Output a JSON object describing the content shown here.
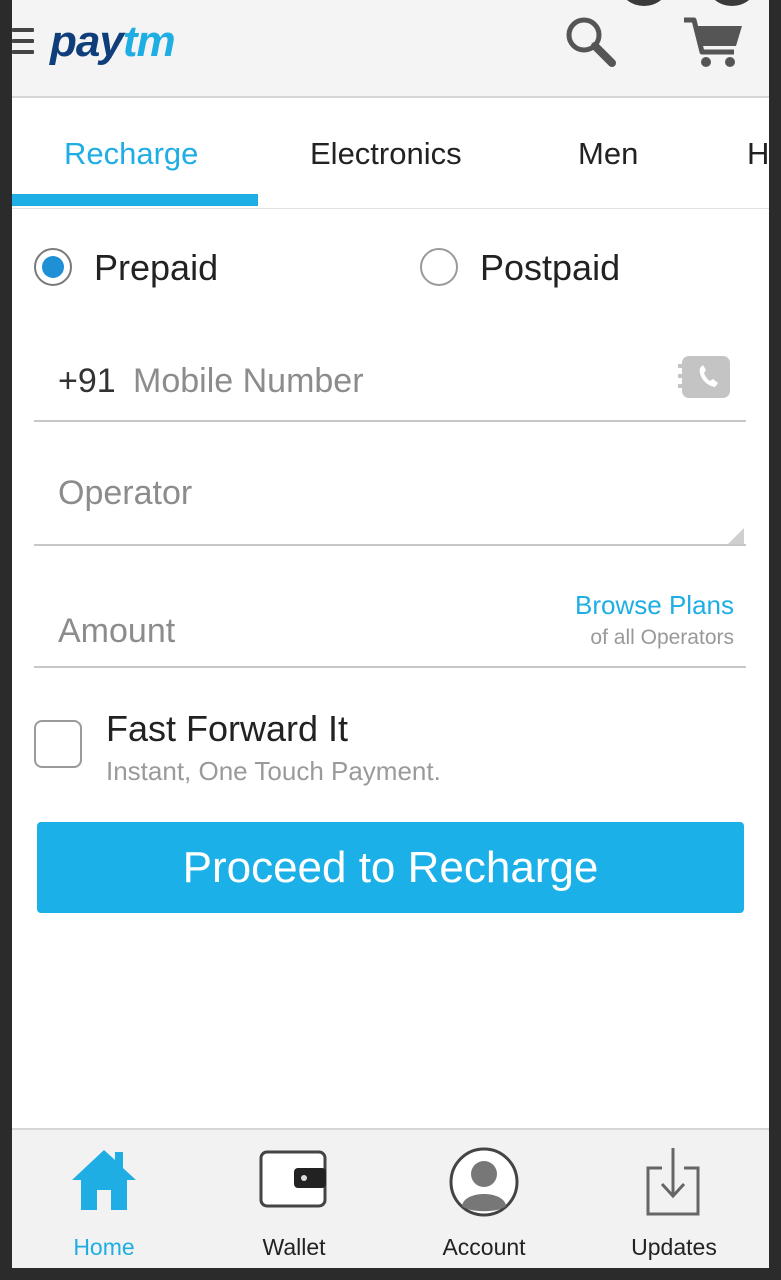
{
  "header": {
    "logo_pay": "pay",
    "logo_tm": "tm",
    "icons": [
      "menu-icon",
      "search-icon",
      "cart-icon"
    ]
  },
  "tabs": [
    {
      "label": "Recharge",
      "active": true
    },
    {
      "label": "Electronics",
      "active": false
    },
    {
      "label": "Men",
      "active": false
    },
    {
      "label": "H",
      "active": false
    }
  ],
  "recharge_type": {
    "options": [
      {
        "label": "Prepaid",
        "selected": true
      },
      {
        "label": "Postpaid",
        "selected": false
      }
    ]
  },
  "form": {
    "mobile_prefix": "+91",
    "mobile_placeholder": "Mobile Number",
    "operator_placeholder": "Operator",
    "amount_placeholder": "Amount",
    "browse_plans": "Browse Plans",
    "browse_plans_sub": "of all Operators"
  },
  "fast_forward": {
    "title": "Fast Forward It",
    "subtitle": "Instant, One Touch Payment.",
    "checked": false
  },
  "proceed_label": "Proceed to Recharge",
  "bottom_nav": [
    {
      "label": "Home",
      "icon": "home-icon",
      "active": true
    },
    {
      "label": "Wallet",
      "icon": "wallet-icon",
      "active": false
    },
    {
      "label": "Account",
      "icon": "account-icon",
      "active": false
    },
    {
      "label": "Updates",
      "icon": "updates-icon",
      "active": false
    }
  ],
  "colors": {
    "accent": "#1faee4",
    "brand_dark": "#0f3e7a",
    "button": "#1cb0e8"
  }
}
